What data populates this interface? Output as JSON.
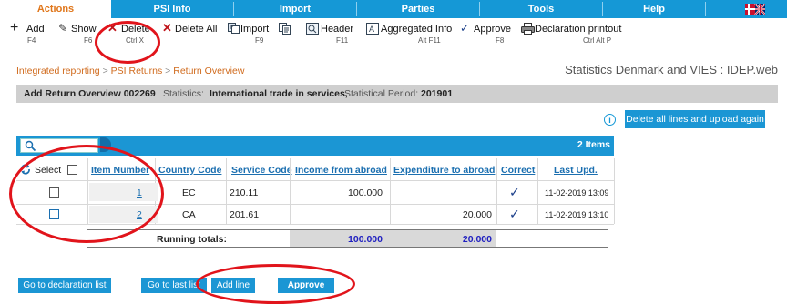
{
  "tabs": [
    {
      "label": "Actions",
      "active": true
    },
    {
      "label": "PSI Info"
    },
    {
      "label": "Import"
    },
    {
      "label": "Parties"
    },
    {
      "label": "Tools"
    },
    {
      "label": "Help"
    }
  ],
  "toolbar": {
    "add": {
      "label": "Add",
      "key": "F4"
    },
    "show": {
      "label": "Show",
      "key": "F6"
    },
    "delete": {
      "label": "Delete",
      "key": "Ctrl X"
    },
    "delete_all": {
      "label": "Delete All"
    },
    "import": {
      "label": "Import",
      "key": "F9"
    },
    "header": {
      "label": "Header",
      "key": "F11"
    },
    "aggregated": {
      "label": "Aggregated Info",
      "key": "Alt F11"
    },
    "approve": {
      "label": "Approve",
      "key": "F8"
    },
    "printout": {
      "label": "Declaration printout",
      "key": "Ctrl Alt P"
    }
  },
  "breadcrumb": [
    "Integrated reporting",
    "PSI Returns",
    "Return Overview"
  ],
  "app_title": "Statistics Denmark and VIES : IDEP.web",
  "return_header": {
    "title": "Add Return Overview 002269",
    "stats_label": "Statistics:",
    "stats_value": "International trade in services,",
    "period_label": "Statistical Period:",
    "period_value": "201901"
  },
  "delete_upload_label": "Delete all lines and upload again",
  "items_count": "2 Items",
  "select_label": "Select",
  "columns": [
    "Item Number",
    "Country Code",
    "Service Code",
    "Income from abroad",
    "Expenditure to abroad",
    "Correct",
    "Last Upd."
  ],
  "rows": [
    {
      "item": "1",
      "country": "EC",
      "service": "210.11",
      "income": "100.000",
      "expenditure": "",
      "updated": "11-02-2019 13:09"
    },
    {
      "item": "2",
      "country": "CA",
      "service": "201.61",
      "income": "",
      "expenditure": "20.000",
      "updated": "11-02-2019 13:10"
    }
  ],
  "totals": {
    "label": "Running totals:",
    "income": "100.000",
    "expenditure": "20.000"
  },
  "bottom_buttons": {
    "declaration_list": "Go to declaration list",
    "last_list": "Go to last list",
    "add_line": "Add line",
    "approve": "Approve"
  },
  "colors": {
    "accent": "#1b96d4",
    "highlight": "#e1141b",
    "breadcrumb": "#d06a1c"
  }
}
